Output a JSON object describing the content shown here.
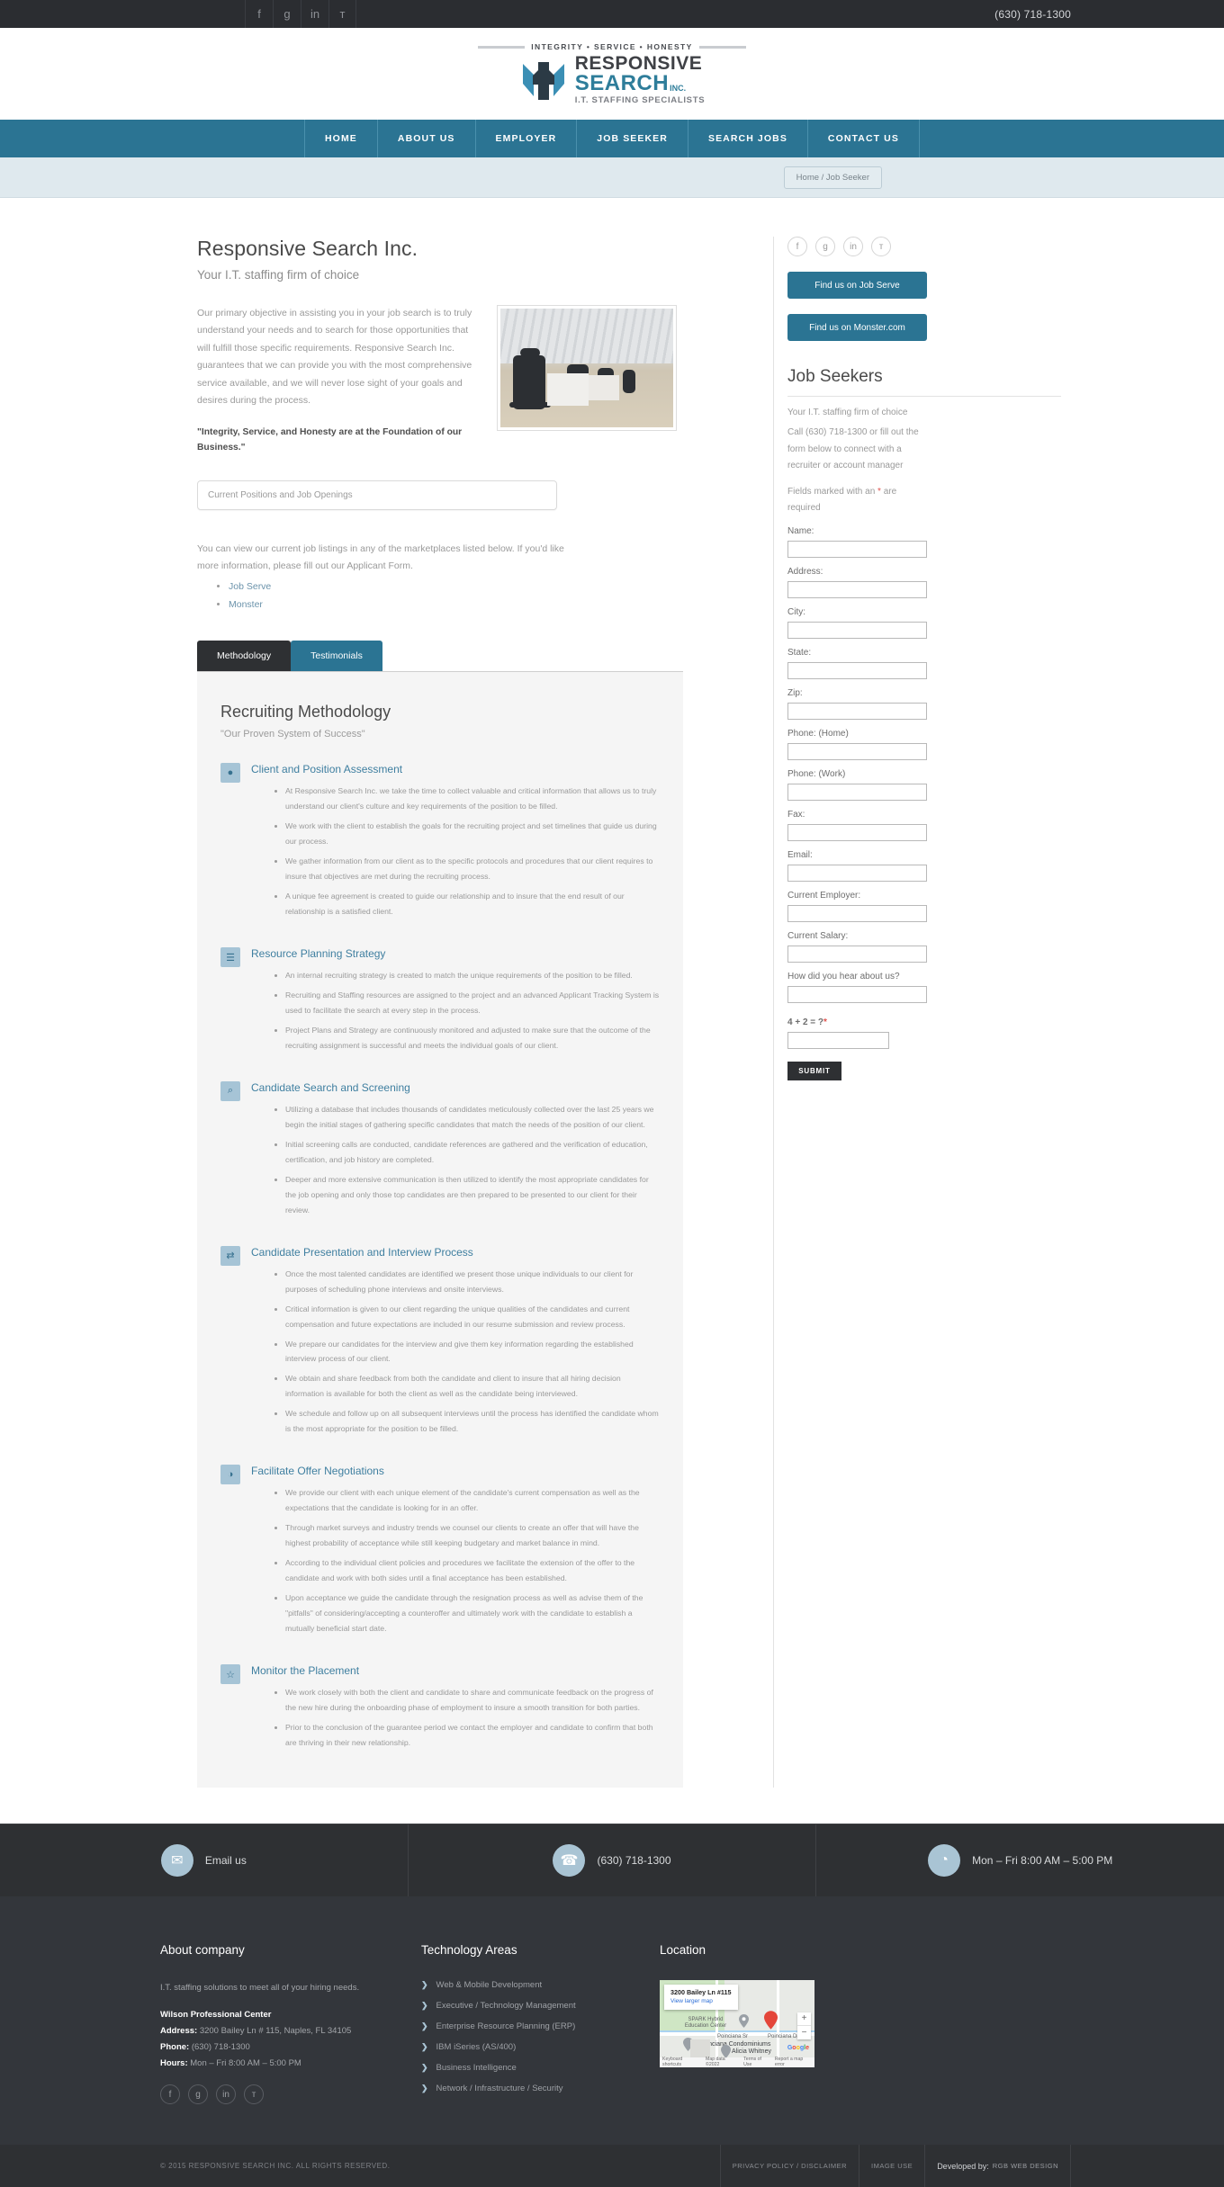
{
  "topbar": {
    "social": [
      {
        "name": "facebook-icon",
        "glyph": "f"
      },
      {
        "name": "google-plus-icon",
        "glyph": "g"
      },
      {
        "name": "linkedin-icon",
        "glyph": "in"
      },
      {
        "name": "twitter-icon",
        "glyph": "ᴛ"
      }
    ],
    "phone": "(630) 718-1300"
  },
  "logo": {
    "tagline": "INTEGRITY • SERVICE • HONESTY",
    "line1": "RESPONSIVE",
    "line2": "SEARCH",
    "line2_suffix": "INC.",
    "line3": "I.T. STAFFING SPECIALISTS"
  },
  "nav": {
    "items": [
      {
        "label": "HOME",
        "key": "home"
      },
      {
        "label": "ABOUT US",
        "key": "about-us"
      },
      {
        "label": "EMPLOYER",
        "key": "employer"
      },
      {
        "label": "JOB SEEKER",
        "key": "job-seeker"
      },
      {
        "label": "SEARCH JOBS",
        "key": "search-jobs"
      },
      {
        "label": "CONTACT US",
        "key": "contact-us"
      }
    ]
  },
  "breadcrumb": "Home / Job Seeker",
  "main": {
    "title": "Responsive Search Inc.",
    "subtitle": "Your I.T. staffing firm of choice",
    "intro": "Our primary objective in assisting you in your job search is to truly understand your needs and to search for those opportunities that will fulfill those specific requirements. Responsive Search Inc. guarantees that we can provide you with the most comprehensive service available, and we will never lose sight of your goals and desires during the process.",
    "intro_bold": "\"Integrity, Service, and Honesty are at the Foundation of our Business.\"",
    "search_placeholder": "Current Positions and Job Openings",
    "marketplace_text": "You can view our current job listings in any of the marketplaces listed below. If you'd like more information, please fill out our Applicant Form.",
    "marketplace_links": [
      {
        "label": "Job Serve",
        "key": "job-serve"
      },
      {
        "label": "Monster",
        "key": "monster"
      }
    ],
    "tabs": [
      {
        "label": "Methodology",
        "key": "methodology",
        "active": true
      },
      {
        "label": "Testimonials",
        "key": "testimonials",
        "active": false
      }
    ],
    "panel_title": "Recruiting Methodology",
    "panel_subtitle": "\"Our Proven System of Success\"",
    "steps": [
      {
        "icon": "user-icon",
        "heading": "Client and Position Assessment",
        "items": [
          "At Responsive Search Inc. we take the time to collect valuable and critical information that allows us to truly understand our client's culture and key requirements of the position to be filled.",
          "We work with the client to establish the goals for the recruiting project and set timelines that guide us during our process.",
          "We gather information from our client as to the specific protocols and procedures that our client requires to insure that objectives are met during the recruiting process.",
          "A unique fee agreement is created to guide our relationship and to insure that the end result of our relationship is a satisfied client."
        ]
      },
      {
        "icon": "clipboard-icon",
        "heading": "Resource Planning Strategy",
        "items": [
          "An internal recruiting strategy is created to match the unique requirements of the position to be filled.",
          "Recruiting and Staffing resources are assigned to the project and an advanced Applicant Tracking System is used to facilitate the search at every step in the process.",
          "Project Plans and Strategy are continuously monitored and adjusted to make sure that the outcome of the recruiting assignment is successful and meets the individual goals of our client."
        ]
      },
      {
        "icon": "search-icon",
        "heading": "Candidate Search and Screening",
        "items": [
          "Utilizing a database that includes thousands of candidates meticulously collected over the last 25 years we begin the initial stages of gathering specific candidates that match the needs of the position of our client.",
          "Initial screening calls are conducted, candidate references are gathered and the verification of education, certification, and job history are completed.",
          "Deeper and more extensive communication is then utilized to identify the most appropriate candidates for the job opening and only those top candidates are then prepared to be presented to our client for their review."
        ]
      },
      {
        "icon": "presentation-icon",
        "heading": "Candidate Presentation and Interview Process",
        "items": [
          "Once the most talented candidates are identified we present those unique individuals to our client for purposes of scheduling phone interviews and onsite interviews.",
          "Critical information is given to our client regarding the unique qualities of the candidates and current compensation and future expectations are included in our resume submission and review process.",
          "We prepare our candidates for the interview and give them key information regarding the established interview process of our client.",
          "We obtain and share feedback from both the candidate and client to insure that all hiring decision information is available for both the client as well as the candidate being interviewed.",
          "We schedule and follow up on all subsequent interviews until the process has identified the candidate whom is the most appropriate for the position to be filled."
        ]
      },
      {
        "icon": "chat-icon",
        "heading": "Facilitate Offer Negotiations",
        "items": [
          "We provide our client with each unique element of the candidate's current compensation as well as the expectations that the candidate is looking for in an offer.",
          "Through market surveys and industry trends we counsel our clients to create an offer that will have the highest probability of acceptance while still keeping budgetary and market balance in mind.",
          "According to the individual client policies and procedures we facilitate the extension of the offer to the candidate and work with both sides until a final acceptance has been established.",
          "Upon acceptance we guide the candidate through the resignation process as well as advise them of the \"pitfalls\" of considering/accepting a counteroffer and ultimately work with the candidate to establish a mutually beneficial start date."
        ]
      },
      {
        "icon": "star-icon",
        "heading": "Monitor the Placement",
        "items": [
          "We work closely with both the client and candidate to share and communicate feedback on the progress of the new hire during the onboarding phase of employment to insure a smooth transition for both parties.",
          "Prior to the conclusion of the guarantee period we contact the employer and candidate to confirm that both are thriving in their new relationship."
        ]
      }
    ]
  },
  "sidebar": {
    "social": [
      {
        "name": "facebook-icon",
        "glyph": "f"
      },
      {
        "name": "google-plus-icon",
        "glyph": "g"
      },
      {
        "name": "linkedin-icon",
        "glyph": "in"
      },
      {
        "name": "twitter-icon",
        "glyph": "ᴛ"
      }
    ],
    "buttons": [
      {
        "label": "Find us on Job Serve",
        "key": "job-serve"
      },
      {
        "label": "Find us on Monster.com",
        "key": "monster"
      }
    ],
    "heading": "Job Seekers",
    "clipped_line": "Your I.T. staffing firm of choice",
    "call_text": "Call (630) 718-1300 or fill out the form below to connect with a recruiter or account manager",
    "required_note_a": "Fields marked with an ",
    "required_note_star": "*",
    "required_note_b": " are required",
    "fields": [
      {
        "label": "Name:",
        "key": "name",
        "value": "",
        "short": false
      },
      {
        "label": "Address:",
        "key": "address",
        "value": "",
        "short": false
      },
      {
        "label": "City:",
        "key": "city",
        "value": "",
        "short": false
      },
      {
        "label": "State:",
        "key": "state",
        "value": "",
        "short": false
      },
      {
        "label": "Zip:",
        "key": "zip",
        "value": "",
        "short": false
      },
      {
        "label": "Phone: (Home)",
        "key": "phone-home",
        "value": "",
        "short": false
      },
      {
        "label": "Phone: (Work)",
        "key": "phone-work",
        "value": "",
        "short": false
      },
      {
        "label": "Fax:",
        "key": "fax",
        "value": "",
        "short": false
      },
      {
        "label": "Email:",
        "key": "email",
        "value": "",
        "short": false
      },
      {
        "label": "Current Employer:",
        "key": "current-employer",
        "value": "",
        "short": false
      },
      {
        "label": "Current Salary:",
        "key": "current-salary",
        "value": "",
        "short": false
      },
      {
        "label": "How did you hear about us?",
        "key": "how-did-you-hear",
        "value": "",
        "short": false
      }
    ],
    "captcha_label": "4 + 2 = ?",
    "captcha_star": "*",
    "submit_label": "SUBMIT"
  },
  "footer_contact": [
    {
      "icon": "envelope-icon",
      "label": "Email us",
      "key": "email-us"
    },
    {
      "icon": "phone-icon",
      "label": "(630) 718-1300",
      "key": "phone"
    },
    {
      "icon": "clock-icon",
      "label": "Mon – Fri 8:00 AM – 5:00 PM",
      "key": "hours"
    }
  ],
  "footer": {
    "about": {
      "heading": "About company",
      "tagline": "I.T. staffing solutions to meet all of your hiring needs.",
      "center": "Wilson Professional Center",
      "address_label": "Address:",
      "address": " 3200 Bailey Ln # 115, Naples, FL 34105",
      "phone_label": "Phone:",
      "phone": " (630) 718-1300",
      "hours_label": "Hours:",
      "hours": " Mon – Fri 8:00 AM – 5:00 PM",
      "social": [
        {
          "name": "facebook-icon",
          "glyph": "f"
        },
        {
          "name": "google-plus-icon",
          "glyph": "g"
        },
        {
          "name": "linkedin-icon",
          "glyph": "in"
        },
        {
          "name": "twitter-icon",
          "glyph": "ᴛ"
        }
      ]
    },
    "tech": {
      "heading": "Technology Areas",
      "items": [
        {
          "label": "Web & Mobile Development",
          "key": "web-mobile"
        },
        {
          "label": "Executive / Technology Management",
          "key": "executive-tech-mgmt"
        },
        {
          "label": "Enterprise Resource Planning (ERP)",
          "key": "erp"
        },
        {
          "label": "IBM iSeries (AS/400)",
          "key": "ibm-iseries"
        },
        {
          "label": "Business Intelligence",
          "key": "business-intelligence"
        },
        {
          "label": "Network / Infrastructure / Security",
          "key": "network-security"
        }
      ]
    },
    "location": {
      "heading": "Location",
      "map_title": "3200 Bailey Ln #115",
      "map_link": "View larger map",
      "map_labels": [
        "SPARK Hybrid Education Center",
        "Poinciana Sr",
        "Poinciana Dr",
        "Poinciana Condominiums",
        "Alicia Whitney"
      ],
      "map_foot": [
        "Keyboard shortcuts",
        "Map data ©2022",
        "Terms of Use",
        "Report a map error"
      ],
      "zoom_in": "+",
      "zoom_out": "−"
    }
  },
  "footer_bottom": {
    "copyright": "© 2015 RESPONSIVE SEARCH INC. ALL RIGHTS RESERVED.",
    "links": [
      {
        "label": "PRIVACY POLICY / DISCLAIMER",
        "key": "privacy-policy"
      },
      {
        "label": "IMAGE USE",
        "key": "image-use"
      }
    ],
    "developed_prefix": "Developed by:",
    "developed_by": "RGB WEB DESIGN"
  },
  "colors": {
    "accent": "#2b7493",
    "dark": "#2e3033",
    "light_blue": "#a9c4d4"
  }
}
